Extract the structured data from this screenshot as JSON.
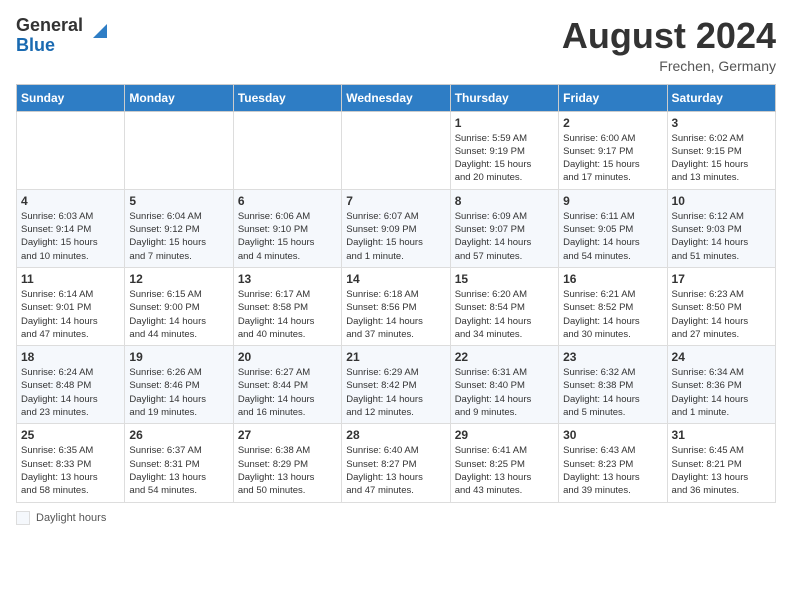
{
  "header": {
    "logo_general": "General",
    "logo_blue": "Blue",
    "month_year": "August 2024",
    "location": "Frechen, Germany"
  },
  "legend": {
    "label": "Daylight hours"
  },
  "days_of_week": [
    "Sunday",
    "Monday",
    "Tuesday",
    "Wednesday",
    "Thursday",
    "Friday",
    "Saturday"
  ],
  "weeks": [
    [
      {
        "day": "",
        "info": ""
      },
      {
        "day": "",
        "info": ""
      },
      {
        "day": "",
        "info": ""
      },
      {
        "day": "",
        "info": ""
      },
      {
        "day": "1",
        "info": "Sunrise: 5:59 AM\nSunset: 9:19 PM\nDaylight: 15 hours\nand 20 minutes."
      },
      {
        "day": "2",
        "info": "Sunrise: 6:00 AM\nSunset: 9:17 PM\nDaylight: 15 hours\nand 17 minutes."
      },
      {
        "day": "3",
        "info": "Sunrise: 6:02 AM\nSunset: 9:15 PM\nDaylight: 15 hours\nand 13 minutes."
      }
    ],
    [
      {
        "day": "4",
        "info": "Sunrise: 6:03 AM\nSunset: 9:14 PM\nDaylight: 15 hours\nand 10 minutes."
      },
      {
        "day": "5",
        "info": "Sunrise: 6:04 AM\nSunset: 9:12 PM\nDaylight: 15 hours\nand 7 minutes."
      },
      {
        "day": "6",
        "info": "Sunrise: 6:06 AM\nSunset: 9:10 PM\nDaylight: 15 hours\nand 4 minutes."
      },
      {
        "day": "7",
        "info": "Sunrise: 6:07 AM\nSunset: 9:09 PM\nDaylight: 15 hours\nand 1 minute."
      },
      {
        "day": "8",
        "info": "Sunrise: 6:09 AM\nSunset: 9:07 PM\nDaylight: 14 hours\nand 57 minutes."
      },
      {
        "day": "9",
        "info": "Sunrise: 6:11 AM\nSunset: 9:05 PM\nDaylight: 14 hours\nand 54 minutes."
      },
      {
        "day": "10",
        "info": "Sunrise: 6:12 AM\nSunset: 9:03 PM\nDaylight: 14 hours\nand 51 minutes."
      }
    ],
    [
      {
        "day": "11",
        "info": "Sunrise: 6:14 AM\nSunset: 9:01 PM\nDaylight: 14 hours\nand 47 minutes."
      },
      {
        "day": "12",
        "info": "Sunrise: 6:15 AM\nSunset: 9:00 PM\nDaylight: 14 hours\nand 44 minutes."
      },
      {
        "day": "13",
        "info": "Sunrise: 6:17 AM\nSunset: 8:58 PM\nDaylight: 14 hours\nand 40 minutes."
      },
      {
        "day": "14",
        "info": "Sunrise: 6:18 AM\nSunset: 8:56 PM\nDaylight: 14 hours\nand 37 minutes."
      },
      {
        "day": "15",
        "info": "Sunrise: 6:20 AM\nSunset: 8:54 PM\nDaylight: 14 hours\nand 34 minutes."
      },
      {
        "day": "16",
        "info": "Sunrise: 6:21 AM\nSunset: 8:52 PM\nDaylight: 14 hours\nand 30 minutes."
      },
      {
        "day": "17",
        "info": "Sunrise: 6:23 AM\nSunset: 8:50 PM\nDaylight: 14 hours\nand 27 minutes."
      }
    ],
    [
      {
        "day": "18",
        "info": "Sunrise: 6:24 AM\nSunset: 8:48 PM\nDaylight: 14 hours\nand 23 minutes."
      },
      {
        "day": "19",
        "info": "Sunrise: 6:26 AM\nSunset: 8:46 PM\nDaylight: 14 hours\nand 19 minutes."
      },
      {
        "day": "20",
        "info": "Sunrise: 6:27 AM\nSunset: 8:44 PM\nDaylight: 14 hours\nand 16 minutes."
      },
      {
        "day": "21",
        "info": "Sunrise: 6:29 AM\nSunset: 8:42 PM\nDaylight: 14 hours\nand 12 minutes."
      },
      {
        "day": "22",
        "info": "Sunrise: 6:31 AM\nSunset: 8:40 PM\nDaylight: 14 hours\nand 9 minutes."
      },
      {
        "day": "23",
        "info": "Sunrise: 6:32 AM\nSunset: 8:38 PM\nDaylight: 14 hours\nand 5 minutes."
      },
      {
        "day": "24",
        "info": "Sunrise: 6:34 AM\nSunset: 8:36 PM\nDaylight: 14 hours\nand 1 minute."
      }
    ],
    [
      {
        "day": "25",
        "info": "Sunrise: 6:35 AM\nSunset: 8:33 PM\nDaylight: 13 hours\nand 58 minutes."
      },
      {
        "day": "26",
        "info": "Sunrise: 6:37 AM\nSunset: 8:31 PM\nDaylight: 13 hours\nand 54 minutes."
      },
      {
        "day": "27",
        "info": "Sunrise: 6:38 AM\nSunset: 8:29 PM\nDaylight: 13 hours\nand 50 minutes."
      },
      {
        "day": "28",
        "info": "Sunrise: 6:40 AM\nSunset: 8:27 PM\nDaylight: 13 hours\nand 47 minutes."
      },
      {
        "day": "29",
        "info": "Sunrise: 6:41 AM\nSunset: 8:25 PM\nDaylight: 13 hours\nand 43 minutes."
      },
      {
        "day": "30",
        "info": "Sunrise: 6:43 AM\nSunset: 8:23 PM\nDaylight: 13 hours\nand 39 minutes."
      },
      {
        "day": "31",
        "info": "Sunrise: 6:45 AM\nSunset: 8:21 PM\nDaylight: 13 hours\nand 36 minutes."
      }
    ]
  ]
}
